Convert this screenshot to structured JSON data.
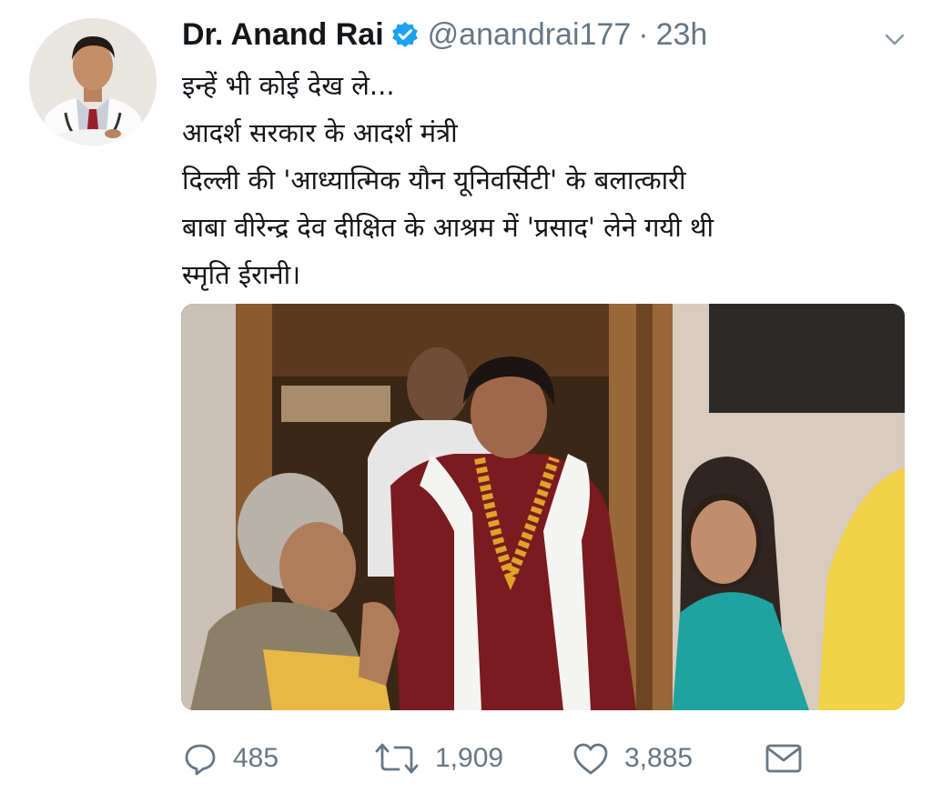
{
  "user": {
    "display_name": "Dr. Anand Rai",
    "handle": "@anandrai177",
    "separator": "·",
    "time": "23h",
    "verified": true
  },
  "tweet": {
    "lines": [
      "इन्हें भी कोई देख ले...",
      "आदर्श सरकार के आदर्श मंत्री",
      "दिल्ली की 'आध्यात्मिक यौन यूनिवर्सिटी' के बलात्कारी",
      "बाबा वीरेन्द्र देव दीक्षित के आश्रम में 'प्रसाद' लेने गयी थी",
      "स्मृति ईरानी।"
    ]
  },
  "actions": {
    "reply_count": "485",
    "retweet_count": "1,909",
    "like_count": "3,885"
  },
  "icons": {
    "reply": "reply-icon",
    "retweet": "retweet-icon",
    "like": "heart-icon",
    "dm": "envelope-icon",
    "menu": "chevron-down-icon",
    "verified": "verified-badge-icon"
  },
  "colors": {
    "verified_blue": "#1da1f2",
    "secondary_text": "#657786",
    "primary_text": "#14171a"
  }
}
